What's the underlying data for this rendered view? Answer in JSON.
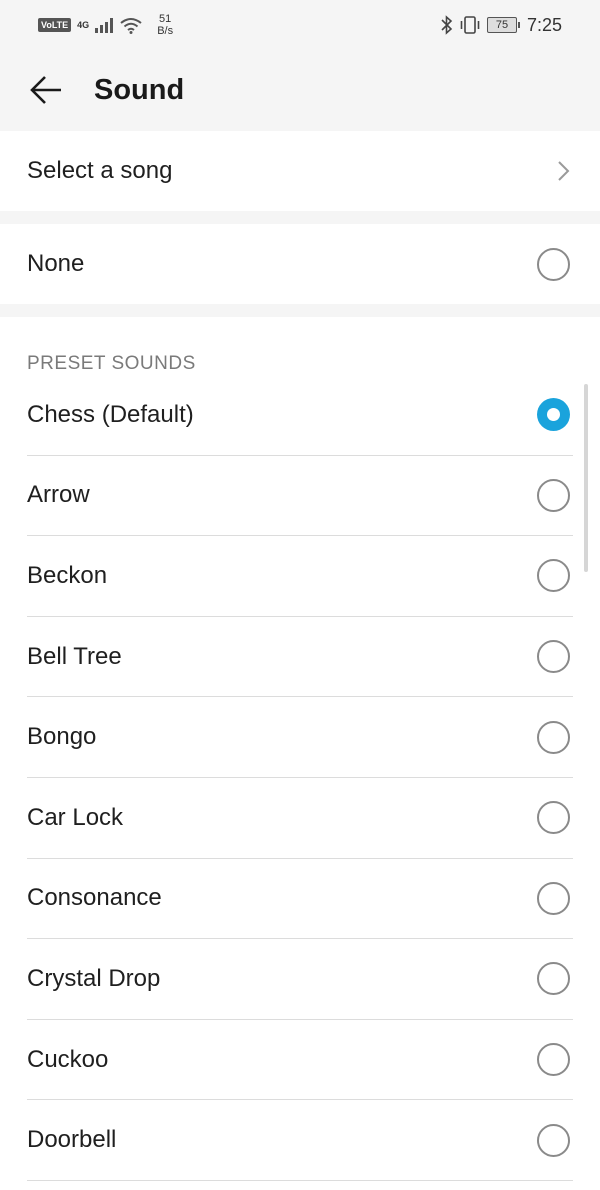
{
  "status_bar": {
    "volte": "VoLTE",
    "network": "4G",
    "speed_value": "51",
    "speed_unit": "B/s",
    "battery": "75",
    "time": "7:25"
  },
  "header": {
    "title": "Sound"
  },
  "select_song": {
    "label": "Select a song"
  },
  "none_option": {
    "label": "None",
    "selected": false
  },
  "preset": {
    "header": "PRESET SOUNDS",
    "items": [
      {
        "label": "Chess (Default)",
        "selected": true
      },
      {
        "label": "Arrow",
        "selected": false
      },
      {
        "label": "Beckon",
        "selected": false
      },
      {
        "label": "Bell Tree",
        "selected": false
      },
      {
        "label": "Bongo",
        "selected": false
      },
      {
        "label": "Car Lock",
        "selected": false
      },
      {
        "label": "Consonance",
        "selected": false
      },
      {
        "label": "Crystal Drop",
        "selected": false
      },
      {
        "label": "Cuckoo",
        "selected": false
      },
      {
        "label": "Doorbell",
        "selected": false
      }
    ]
  },
  "colors": {
    "accent": "#1aa3dc",
    "background": "#f5f5f5",
    "card": "#ffffff"
  }
}
